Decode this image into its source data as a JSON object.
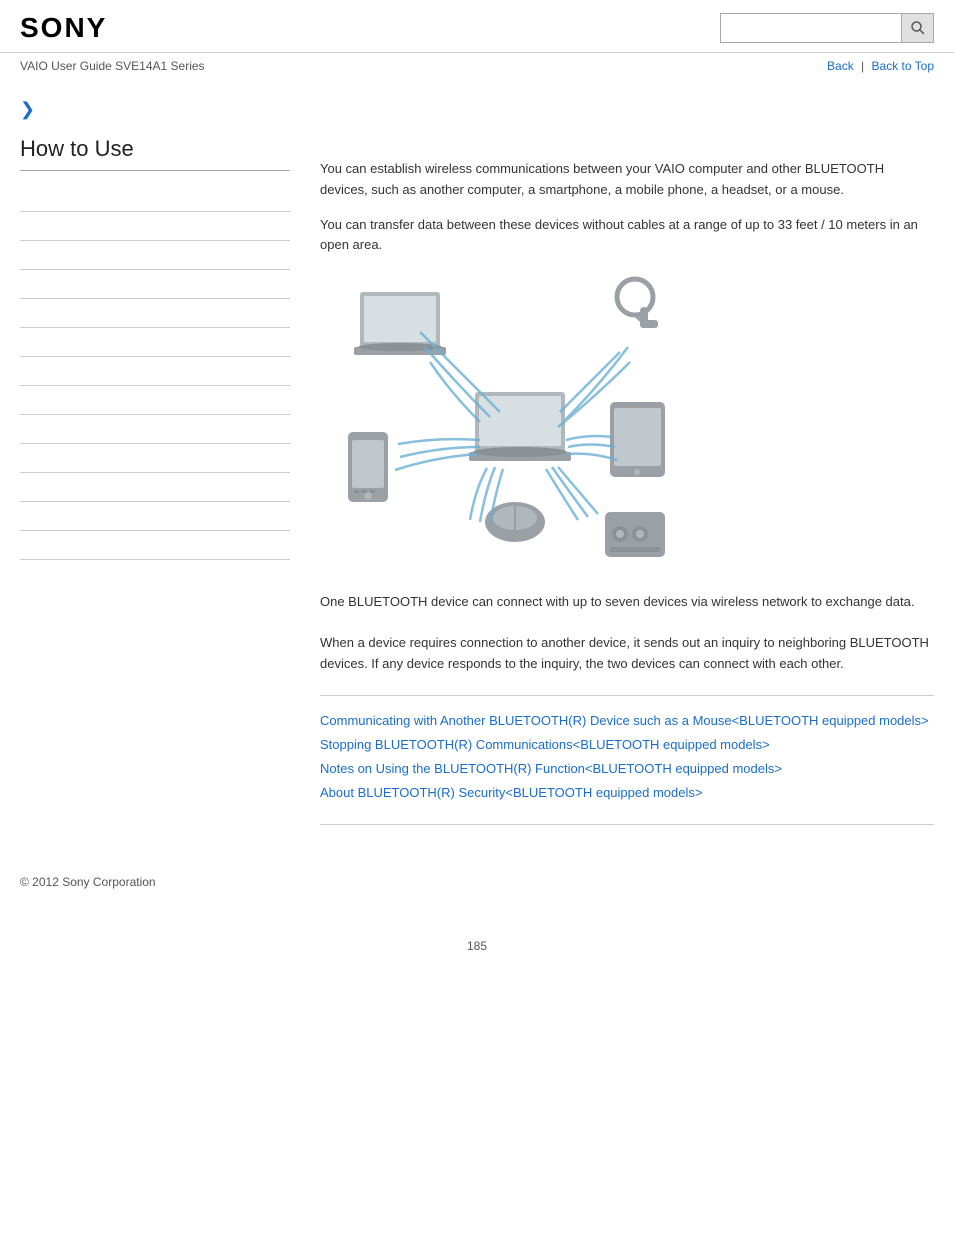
{
  "header": {
    "logo": "SONY",
    "search_placeholder": ""
  },
  "subheader": {
    "breadcrumb": "VAIO User Guide SVE14A1 Series",
    "back_label": "Back",
    "back_to_top_label": "Back to Top"
  },
  "sidebar": {
    "arrow": "❯",
    "section_title": "How to Use",
    "nav_items": [
      {
        "label": ""
      },
      {
        "label": ""
      },
      {
        "label": ""
      },
      {
        "label": ""
      },
      {
        "label": ""
      },
      {
        "label": ""
      },
      {
        "label": ""
      },
      {
        "label": ""
      },
      {
        "label": ""
      },
      {
        "label": ""
      },
      {
        "label": ""
      },
      {
        "label": ""
      },
      {
        "label": ""
      }
    ]
  },
  "content": {
    "intro_para1": "You can establish wireless communications between your VAIO computer and other BLUETOOTH devices, such as another computer, a smartphone, a mobile phone, a headset, or a mouse.",
    "intro_para2": "You can transfer data between these devices without cables at a range of up to 33 feet / 10 meters in an open area.",
    "body_para1": "One BLUETOOTH device can connect with up to seven devices via wireless network to exchange data.",
    "body_para2": "When a device requires connection to another device, it sends out an inquiry to neighboring BLUETOOTH devices. If any device responds to the inquiry, the two devices can connect with each other.",
    "related_links": [
      {
        "label": "Communicating with Another BLUETOOTH(R) Device such as a Mouse<BLUETOOTH equipped models>"
      },
      {
        "label": "Stopping BLUETOOTH(R) Communications<BLUETOOTH equipped models>"
      },
      {
        "label": "Notes on Using the BLUETOOTH(R) Function<BLUETOOTH equipped models>"
      },
      {
        "label": "About BLUETOOTH(R) Security<BLUETOOTH equipped models>"
      }
    ]
  },
  "footer": {
    "copyright": "© 2012 Sony Corporation"
  },
  "page_number": "185"
}
